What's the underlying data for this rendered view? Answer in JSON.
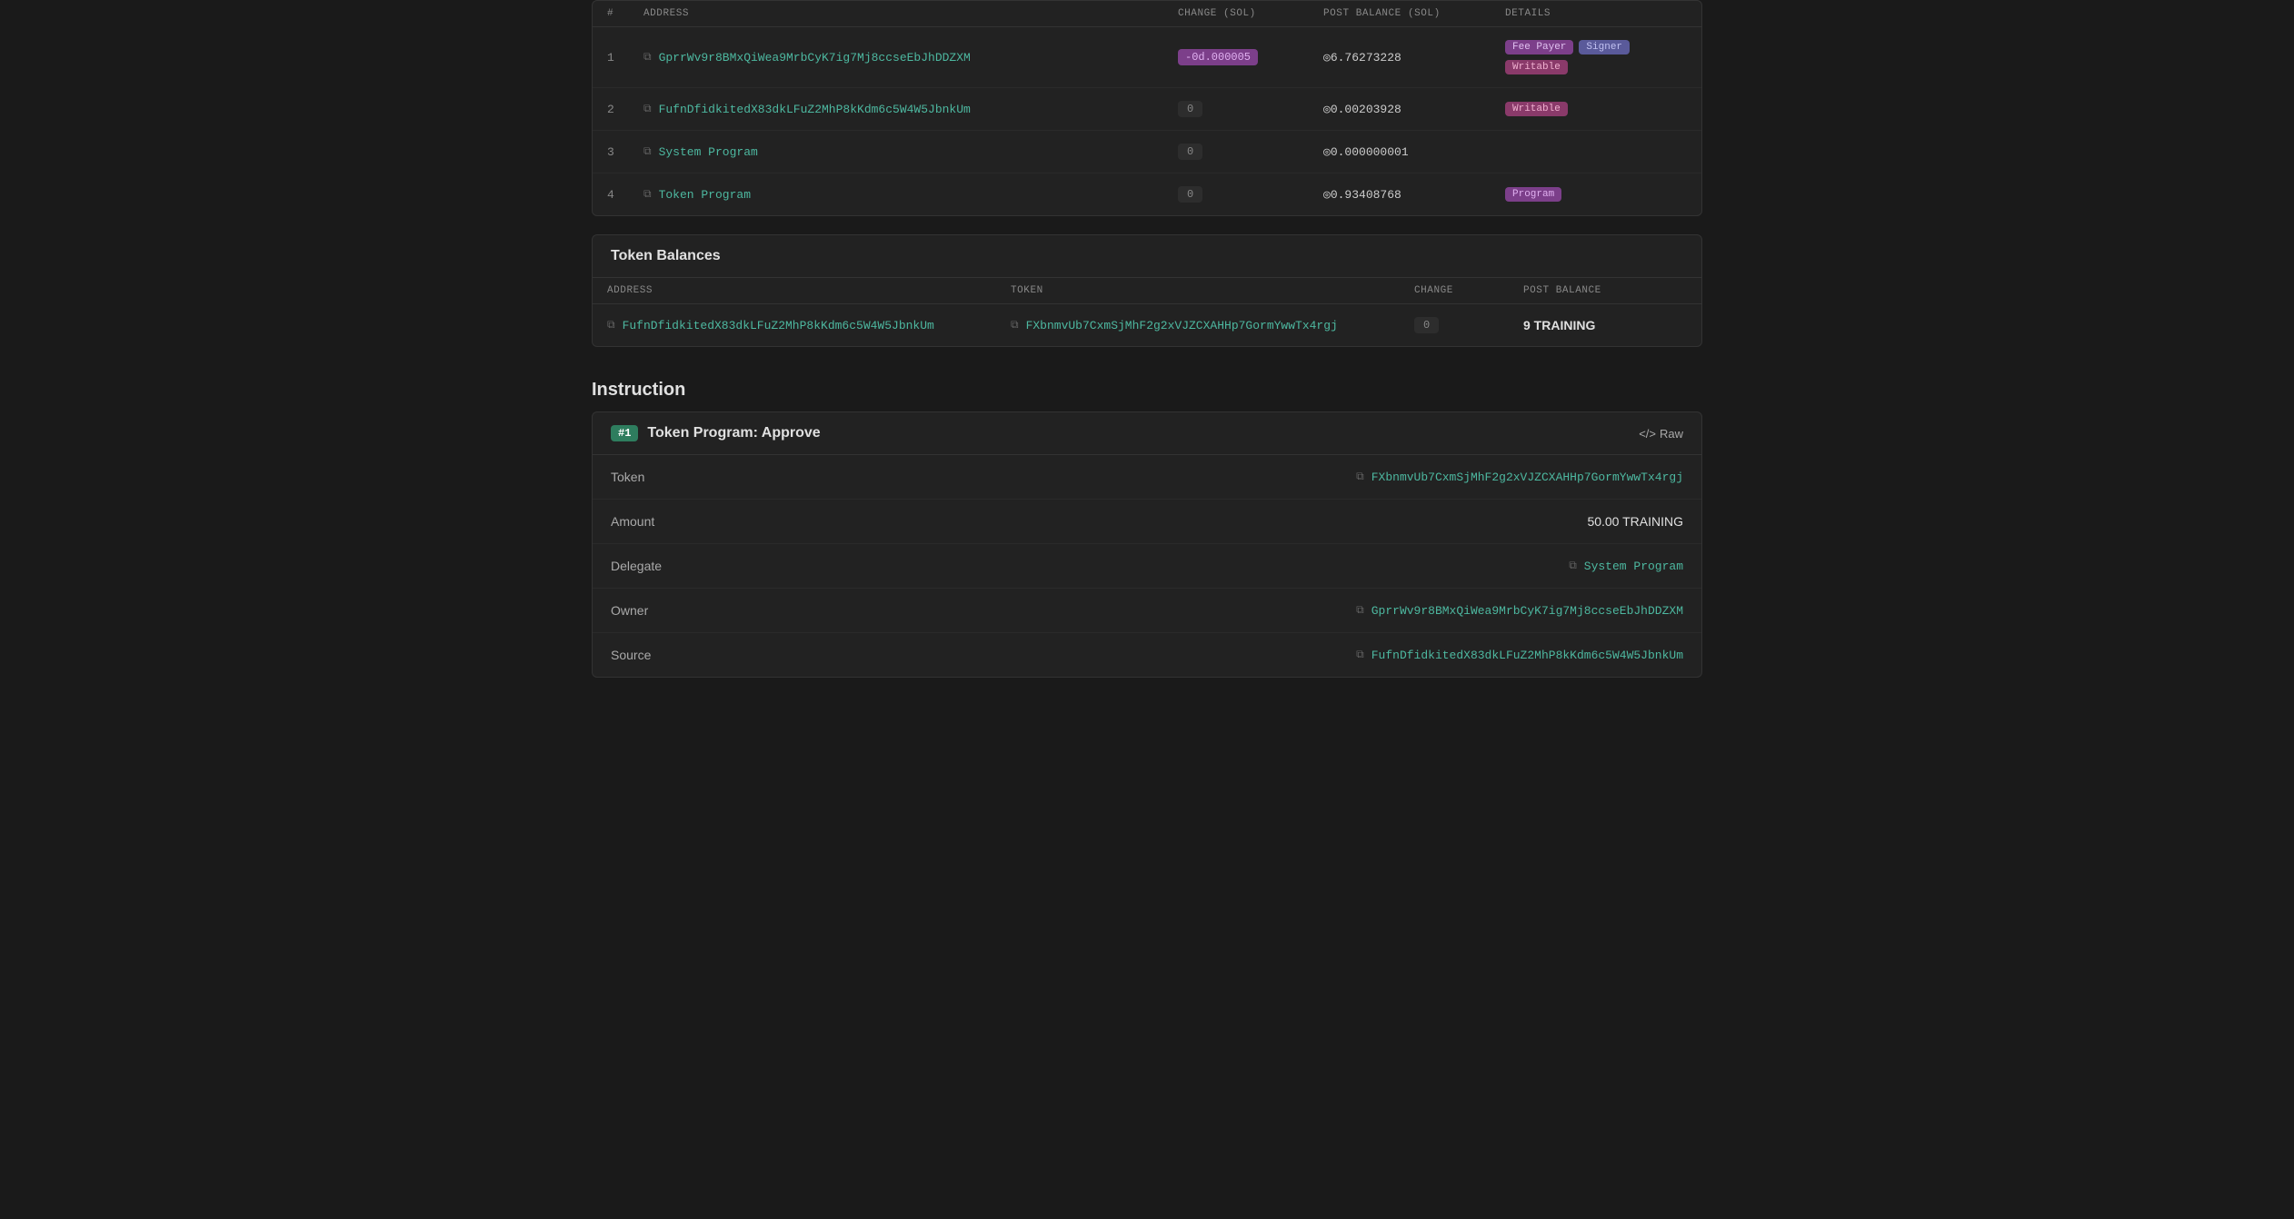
{
  "accounts_table": {
    "columns": [
      "#",
      "ADDRESS",
      "CHANGE (SOL)",
      "POST BALANCE (SOL)",
      "DETAILS"
    ],
    "rows": [
      {
        "num": "1",
        "address": "GprrWv9r8BMxQiWea9MrbCyK7ig7Mj8ccseEbJhDDZXM",
        "change": "-0d.000005",
        "change_type": "negative",
        "post_balance": "◎6.76273228",
        "badges": [
          "Fee Payer",
          "Signer",
          "Writable"
        ]
      },
      {
        "num": "2",
        "address": "FufnDfidkitedX83dkLFuZ2MhP8kKdm6c5W4W5JbnkUm",
        "change": "0",
        "change_type": "zero",
        "post_balance": "◎0.00203928",
        "badges": [
          "Writable"
        ]
      },
      {
        "num": "3",
        "address": "System Program",
        "change": "0",
        "change_type": "zero",
        "post_balance": "◎0.000000001",
        "badges": []
      },
      {
        "num": "4",
        "address": "Token Program",
        "change": "0",
        "change_type": "zero",
        "post_balance": "◎0.93408768",
        "badges": [
          "Program"
        ]
      }
    ]
  },
  "token_balances": {
    "section_title": "Token Balances",
    "columns": [
      "ADDRESS",
      "TOKEN",
      "CHANGE",
      "POST BALANCE"
    ],
    "rows": [
      {
        "address": "FufnDfidkitedX83dkLFuZ2MhP8kKdm6c5W4W5JbnkUm",
        "token": "FXbnmvUb7CxmSjMhF2g2xVJZCXAHHp7GormYwwTx4rgj",
        "change": "0",
        "post_balance": "9 TRAINING"
      }
    ]
  },
  "instruction_section": {
    "title": "Instruction",
    "cards": [
      {
        "number": "#1",
        "name": "Token Program: Approve",
        "raw_label": "Raw",
        "fields": [
          {
            "label": "Token",
            "value": "FXbnmvUb7CxmSjMhF2g2xVJZCXAHHp7GormYwwTx4rgj",
            "type": "address"
          },
          {
            "label": "Amount",
            "value": "50.00 TRAINING",
            "type": "text"
          },
          {
            "label": "Delegate",
            "value": "System Program",
            "type": "address_green"
          },
          {
            "label": "Owner",
            "value": "GprrWv9r8BMxQiWea9MrbCyK7ig7Mj8ccseEbJhDDZXM",
            "type": "address"
          },
          {
            "label": "Source",
            "value": "FufnDfidkitedX83dkLFuZ2MhP8kKdm6c5W4W5JbnkUm",
            "type": "address"
          }
        ]
      }
    ]
  }
}
